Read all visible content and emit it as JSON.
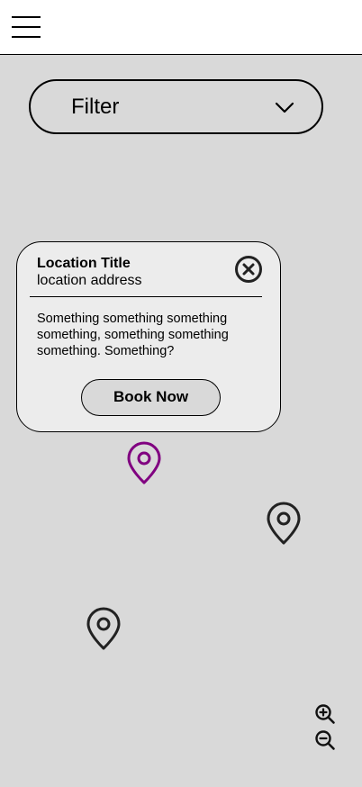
{
  "header": {
    "menu_icon": "hamburger-menu-icon"
  },
  "filter": {
    "label": "Filter",
    "icon": "chevron-down-icon"
  },
  "popup": {
    "title": "Location Title",
    "address": "location address",
    "description": "Something something something something, something something something. Something?",
    "close_icon": "close-circle-icon",
    "book_button_label": "Book Now"
  },
  "map": {
    "pins": [
      {
        "icon": "map-pin-icon",
        "selected": true,
        "color": "#800080"
      },
      {
        "icon": "map-pin-icon",
        "selected": false,
        "color": "#222222"
      },
      {
        "icon": "map-pin-icon",
        "selected": false,
        "color": "#222222"
      }
    ],
    "zoom_in_icon": "zoom-in-icon",
    "zoom_out_icon": "zoom-out-icon"
  },
  "colors": {
    "map_background": "#d9d9d9",
    "popup_background": "#ececec",
    "selected_pin": "#800080",
    "pin": "#222222"
  }
}
